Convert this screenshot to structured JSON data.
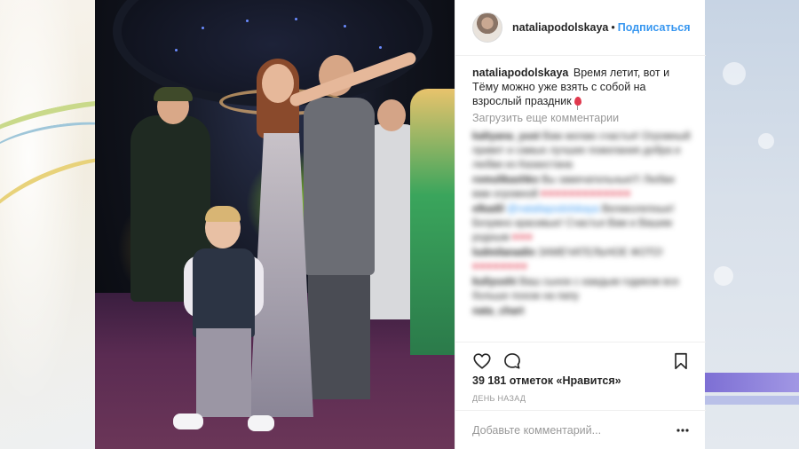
{
  "header": {
    "username": "nataliapodolskaya",
    "separator": "•",
    "follow_label": "Подписаться"
  },
  "caption": {
    "username": "nataliapodolskaya",
    "text": "Время летит, вот и Тёму можно уже взять с собой на взрослый праздник"
  },
  "load_more_label": "Загрузить еще комментарии",
  "comments": [
    {
      "user": "kaltyana_yust",
      "text": "Вам желаю счастья! Огромный привет и самые лучшие пожелания добра и любви из Казахстана"
    },
    {
      "user": "romulikashko",
      "text": "Вы замечательные!!! Любви вам огромной",
      "emoji": "♥♥♥♥♥♥♥♥♥♥♥♥♥"
    },
    {
      "user": "elkadil",
      "mention": "@nataliapodolskaya",
      "text": "Великолепные! Безумно красивые! Счастья Вам и Вашим родным",
      "emoji": "♥♥♥"
    },
    {
      "user": "ludmilanadin",
      "text": "ЗАМЕЧАТЕЛЬНОЕ ФОТО!",
      "emoji": "♥♥♥♥♥♥♥♥"
    },
    {
      "user": "kuliyushi",
      "text": "Ваш сынок с каждым годиком все больше похож на папу"
    },
    {
      "user": "nata_chart",
      "text": ""
    }
  ],
  "actions": {
    "like_icon": "heart-icon",
    "comment_icon": "comment-icon",
    "save_icon": "bookmark-icon"
  },
  "likes_label": "39 181 отметок «Нравится»",
  "time_label": "ДЕНЬ НАЗАД",
  "add_comment": {
    "placeholder": "Добавьте комментарий...",
    "more_icon": "more-icon"
  },
  "colors": {
    "link_blue": "#3897f0",
    "text": "#262626",
    "muted": "#999999",
    "border": "#efefef"
  }
}
